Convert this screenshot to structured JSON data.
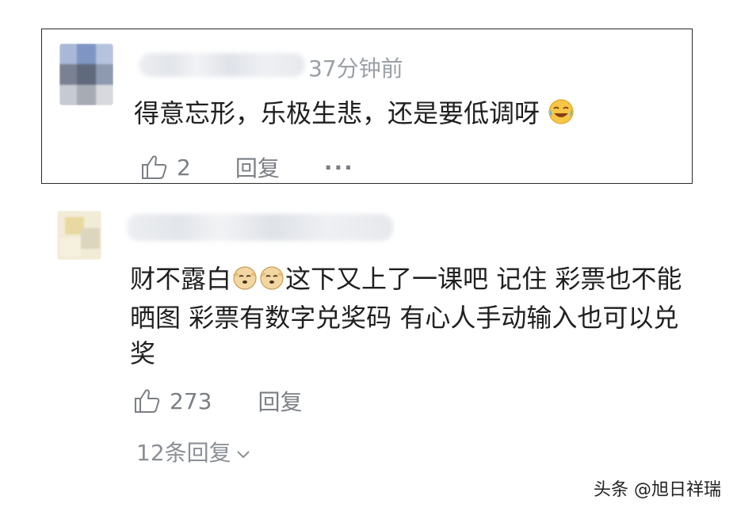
{
  "comments": [
    {
      "time": "37分钟前",
      "text": "得意忘形，乐极生悲，还是要低调呀",
      "emoji": "laughing-tears-emoji",
      "likes": "2",
      "reply_label": "回复",
      "more_label": "···"
    },
    {
      "text_lines": [
        "财不露白",
        "这下又上了一课吧 记住 彩票也不能",
        "晒图 彩票有数字兑奖码 有心人手动输入也可以兑",
        "奖"
      ],
      "emoji": "doge-emoji",
      "likes": "273",
      "reply_label": "回复",
      "replies_count_label": "12条回复"
    }
  ],
  "watermark": "头条 @旭日祥瑞",
  "icons": {
    "like": "thumbs-up-icon",
    "more": "more-dots-icon",
    "chevron": "chevron-down-icon"
  },
  "colors": {
    "text": "#1f1f1f",
    "muted": "#7b7f85",
    "time": "#9aa0a6",
    "border": "#2a2a2a"
  }
}
